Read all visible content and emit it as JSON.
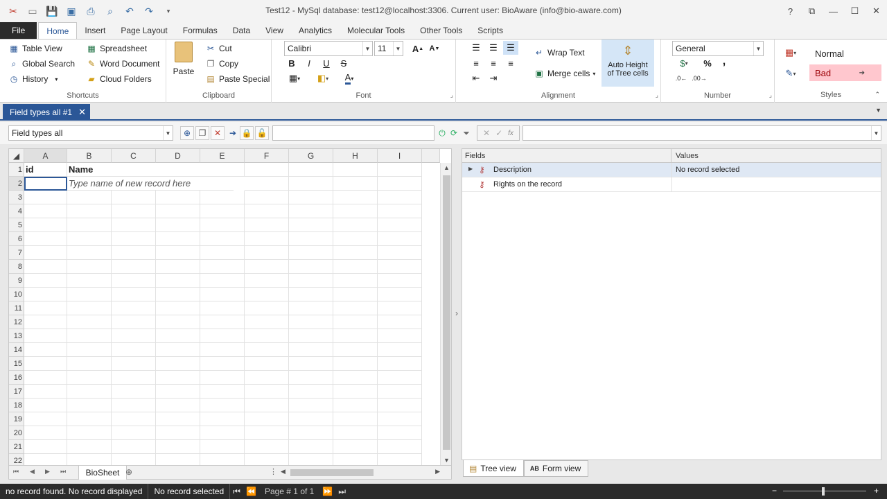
{
  "window": {
    "title": "Test12 - MySql database: test12@localhost:3306. Current user: BioAware (info@bio-aware.com)",
    "help": "?"
  },
  "ribbon_tabs": [
    {
      "label": "File"
    },
    {
      "label": "Home"
    },
    {
      "label": "Insert"
    },
    {
      "label": "Page Layout"
    },
    {
      "label": "Formulas"
    },
    {
      "label": "Data"
    },
    {
      "label": "View"
    },
    {
      "label": "Analytics"
    },
    {
      "label": "Molecular Tools"
    },
    {
      "label": "Other Tools"
    },
    {
      "label": "Scripts"
    }
  ],
  "shortcuts": {
    "label": "Shortcuts",
    "items": [
      "Table View",
      "Global Search",
      "History",
      "Spreadsheet",
      "Word Document",
      "Cloud Folders"
    ]
  },
  "clipboard": {
    "label": "Clipboard",
    "paste": "Paste",
    "cut": "Cut",
    "copy": "Copy",
    "paste_special": "Paste Special"
  },
  "font": {
    "label": "Font",
    "family": "Calibri",
    "size": "11",
    "bold": "B",
    "italic": "I",
    "underline": "U",
    "strike": "S"
  },
  "alignment": {
    "label": "Alignment",
    "wrap_text": "Wrap Text",
    "merge_cells": "Merge cells",
    "auto_height_1": "Auto Height",
    "auto_height_2": "of Tree cells"
  },
  "number": {
    "label": "Number",
    "format": "General",
    "percent": "%",
    "comma": ","
  },
  "styles": {
    "label": "Styles",
    "normal": "Normal",
    "bad": "Bad"
  },
  "document_tab": {
    "label": "Field types all #1"
  },
  "toolbar": {
    "view_select": "Field types all"
  },
  "sheet": {
    "columns": [
      "A",
      "B",
      "C",
      "D",
      "E",
      "F",
      "G",
      "H",
      "I"
    ],
    "rows": [
      "1",
      "2",
      "3",
      "4",
      "5",
      "6",
      "7",
      "8",
      "9",
      "10",
      "11",
      "12",
      "13",
      "14",
      "15",
      "16",
      "17",
      "18",
      "19",
      "20",
      "21",
      "22"
    ],
    "header_id": "id",
    "header_name": "Name",
    "new_record_hint": "Type name of new record here",
    "tab_name": "BioSheet"
  },
  "fields_panel": {
    "col_fields": "Fields",
    "col_values": "Values",
    "rows": [
      {
        "name": "Description",
        "value": "No record selected"
      },
      {
        "name": "Rights on the record",
        "value": ""
      }
    ],
    "tree_view": "Tree view",
    "form_view": "Form view"
  },
  "status": {
    "message": "no record found. No record displayed",
    "selection": "No record selected",
    "page": "Page # 1 of 1"
  },
  "colors": {
    "accent": "#2b5797",
    "bad_style_bg": "#ffc7ce",
    "bad_style_fg": "#9c0006"
  }
}
